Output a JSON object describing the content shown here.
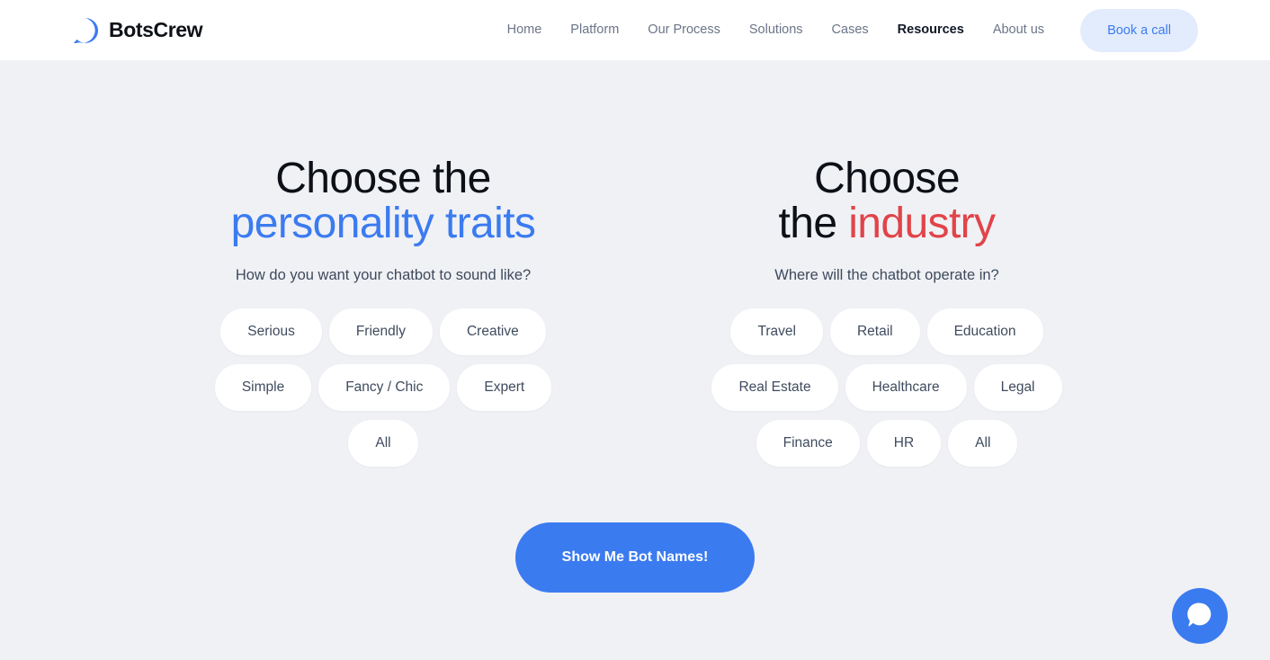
{
  "header": {
    "brand": {
      "name": "BotsCrew",
      "icon": "botscrew-logo-icon"
    },
    "nav": [
      {
        "label": "Home",
        "active": false
      },
      {
        "label": "Platform",
        "active": false
      },
      {
        "label": "Our Process",
        "active": false
      },
      {
        "label": "Solutions",
        "active": false
      },
      {
        "label": "Cases",
        "active": false
      },
      {
        "label": "Resources",
        "active": true
      },
      {
        "label": "About us",
        "active": false
      }
    ],
    "cta_label": "Book a call"
  },
  "columns": [
    {
      "heading_line1": "Choose the",
      "heading_line2": "personality traits",
      "accent": "blue",
      "accent_color": "#3b7bf0",
      "subtitle": "How do you want your chatbot to sound like?",
      "rows": [
        [
          "Serious",
          "Friendly",
          "Creative"
        ],
        [
          "Simple",
          "Fancy / Chic",
          "Expert"
        ],
        [
          "All"
        ]
      ]
    },
    {
      "heading_line1": "Choose",
      "heading_line2_plain": "the ",
      "heading_line2_accent": "industry",
      "accent": "red",
      "accent_color": "#e04449",
      "subtitle": "Where will the chatbot operate in?",
      "rows": [
        [
          "Travel",
          "Retail",
          "Education"
        ],
        [
          "Real Estate",
          "Healthcare",
          "Legal"
        ],
        [
          "Finance",
          "HR",
          "All"
        ]
      ]
    }
  ],
  "cta": {
    "label": "Show Me Bot Names!",
    "color": "#3b7bf0"
  },
  "chat_widget": {
    "icon": "chat-bubble-icon",
    "color": "#3b7bf0"
  },
  "theme": {
    "page_background": "#f0f1f5",
    "header_background": "#ffffff",
    "pill_background": "#ffffff",
    "text_dark": "#0d1117",
    "text_muted": "#6b7588"
  }
}
